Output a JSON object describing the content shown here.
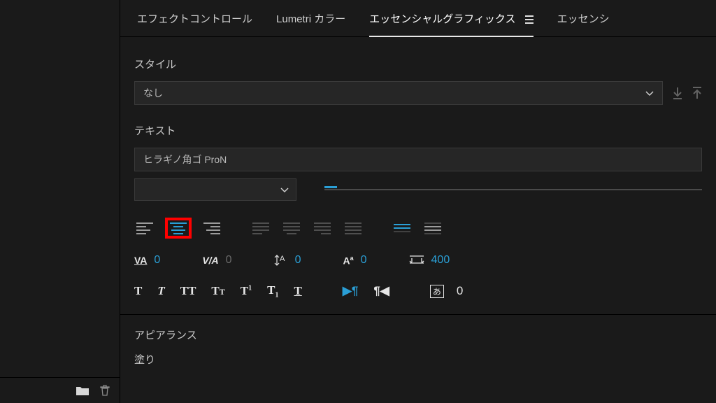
{
  "tabs": {
    "effect_controls": "エフェクトコントロール",
    "lumetri": "Lumetri カラー",
    "essential_graphics": "エッセンシャルグラフィックス",
    "essential_cut": "エッセンシ"
  },
  "style": {
    "label": "スタイル",
    "value": "なし"
  },
  "text": {
    "label": "テキスト",
    "font": "ヒラギノ角ゴ ProN"
  },
  "metrics": {
    "tracking": "0",
    "kerning": "0",
    "leading": "0",
    "baseline": "0",
    "tsume": "400",
    "indent": "0"
  },
  "appearance": {
    "label": "アピアランス",
    "fill": "塗り"
  }
}
